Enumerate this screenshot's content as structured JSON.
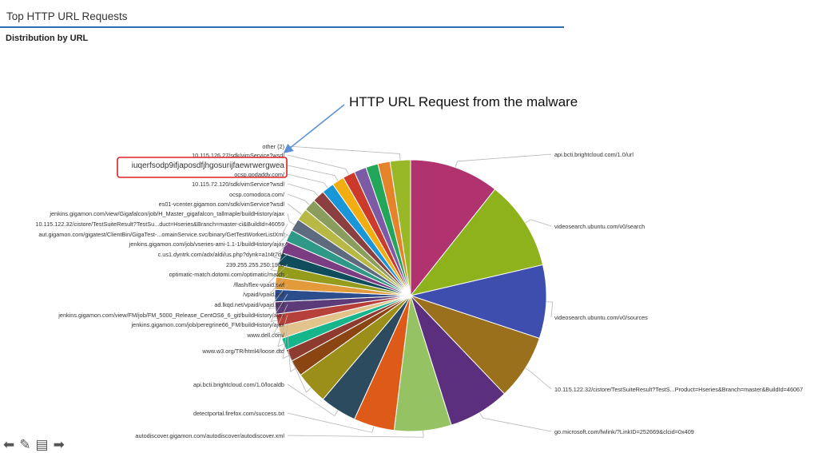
{
  "header": {
    "title": "Top HTTP URL Requests"
  },
  "subtitle": "Distribution by URL",
  "annotation": {
    "text": "HTTP URL Request from the malware"
  },
  "toolbar": [
    {
      "name": "back-icon",
      "glyph": "⬅"
    },
    {
      "name": "edit-icon",
      "glyph": "✎"
    },
    {
      "name": "save-icon",
      "glyph": "▤"
    },
    {
      "name": "forward-icon",
      "glyph": "➡"
    }
  ],
  "chart_data": {
    "type": "pie",
    "title": "Distribution by URL",
    "start_angle_deg": 0,
    "slices": [
      {
        "label": "api.bcti.brightcloud.com/1.0/url",
        "value": 11.0,
        "color": "#b0336f"
      },
      {
        "label": "videosearch.ubuntu.com/v0/search",
        "value": 11.0,
        "color": "#8eb21c"
      },
      {
        "label": "videosearch.ubuntu.com/v0/sources",
        "value": 9.0,
        "color": "#3d4eaf"
      },
      {
        "label": "10.115.122.32/cistore/TestSuiteResult?TestS...Product=Hseries&Branch=master&BuildId=46067",
        "value": 8.0,
        "color": "#9a701c"
      },
      {
        "label": "go.microsoft.com/fwlink/?LinkID=252669&clcid=0x409",
        "value": 7.5,
        "color": "#5c2f7e"
      },
      {
        "label": "autodiscover.gigamon.com/autodiscover/autodiscover.xml",
        "value": 7.0,
        "color": "#95c263"
      },
      {
        "label": "detectportal.firefox.com/success.txt",
        "value": 5.0,
        "color": "#dd5a18"
      },
      {
        "label": "api.bcti.brightcloud.com/1.0/localdb",
        "value": 4.5,
        "color": "#2d4b5f"
      },
      {
        "label": "www.w3.org/TR/html4/loose.dtd",
        "value": 4.0,
        "color": "#9b8f1a"
      },
      {
        "label": "www.dell.com/",
        "value": 2.0,
        "color": "#8b4513"
      },
      {
        "label": "jenkins.gigamon.com/job/peregrine66_FM/buildHistory/ajax",
        "value": 1.5,
        "color": "#8d3b2e"
      },
      {
        "label": "jenkins.gigamon.com/view/FM/job/FM_5000_Release_CentOS6_6_git/buildHistory/ajax",
        "value": 1.5,
        "color": "#16b58c"
      },
      {
        "label": "ad.lkqd.net/vpaid/vpaid.swf",
        "value": 1.5,
        "color": "#e3c38c"
      },
      {
        "label": "/vpaid/vpaid.swf",
        "value": 1.5,
        "color": "#b5413a"
      },
      {
        "label": "/flash/flex-vpaid.swf",
        "value": 1.5,
        "color": "#5d3a78"
      },
      {
        "label": "optimatic-match.dotomi.com/optimatic/match",
        "value": 1.5,
        "color": "#2b4d8c"
      },
      {
        "label": "239.255.255.250:1900",
        "value": 1.5,
        "color": "#e29a3a"
      },
      {
        "label": "c.us1.dyntrk.com/adx/aldi/us.php?dynk=a1t4t7d4",
        "value": 1.5,
        "color": "#959b1a"
      },
      {
        "label": "jenkins.gigamon.com/job/vseries-ami-1.1-1/buildHistory/ajax",
        "value": 1.5,
        "color": "#0f4c5c"
      },
      {
        "label": "aut.gigamon.com/gigatest/ClientBin/GigaTest-...omainService.svc/binary/GetTestWorkerListXml",
        "value": 1.5,
        "color": "#7a3d82"
      },
      {
        "label": "10.115.122.32/cistore/TestSuiteResult?TestSu...duct=Hseries&Branch=master-ci&BuildId=46059",
        "value": 1.5,
        "color": "#2e9987"
      },
      {
        "label": "jenkins.gigamon.com/view/Gigafalcon/job/H_Master_gigafalcon_tallmaple/buildHistory/ajax",
        "value": 1.5,
        "color": "#5e6b7e"
      },
      {
        "label": "es01-vcenter.gigamon.com/sdk/vimService?wsdl",
        "value": 1.5,
        "color": "#b8b845"
      },
      {
        "label": "ocsp.comodoca.com/",
        "value": 1.5,
        "color": "#8a9d5d"
      },
      {
        "label": "10.115.72.120/sdk/vimService?wsdl",
        "value": 1.5,
        "color": "#8c3f3f"
      },
      {
        "label": "ocsp.godaddy.com/",
        "value": 1.5,
        "color": "#1996d8"
      },
      {
        "label": "iuqerfsodp9ifjaposdfjhgosurijfaewrwergwea",
        "value": 1.5,
        "color": "#f2ad10"
      },
      {
        "label": "10.115.126.27/sdk/vimService?wsdl",
        "value": 1.5,
        "color": "#cc3a2c"
      },
      {
        "label": "",
        "value": 1.5,
        "color": "#7d5aa6"
      },
      {
        "label": "",
        "value": 1.5,
        "color": "#23a55a"
      },
      {
        "label": "",
        "value": 1.5,
        "color": "#e5832a"
      },
      {
        "label": "other (2)",
        "value": 2.5,
        "color": "#98b828"
      }
    ]
  }
}
